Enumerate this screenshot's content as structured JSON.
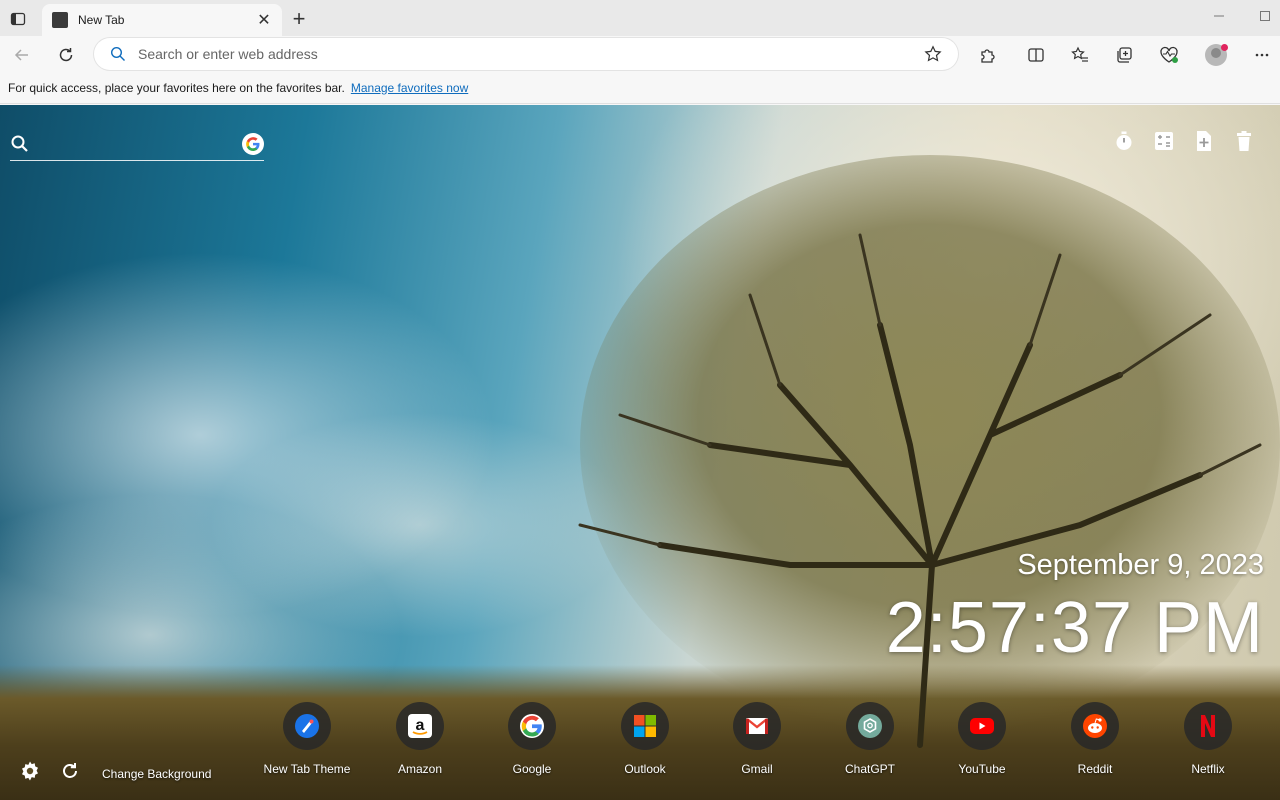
{
  "browser": {
    "tab": {
      "title": "New Tab"
    },
    "new_tab_symbol": "+",
    "close_symbol": "✕",
    "address": {
      "placeholder": "Search or enter web address",
      "value": ""
    }
  },
  "favorites_bar": {
    "message": "For quick access, place your favorites here on the favorites bar.",
    "link": "Manage favorites now"
  },
  "page": {
    "search": {
      "placeholder": "",
      "engine_icon": "google-icon"
    },
    "date": "September 9, 2023",
    "time": "2:57:37 PM",
    "change_background": "Change Background",
    "shortcuts": [
      {
        "label": "New Tab Theme",
        "icon": "new-tab-theme-icon"
      },
      {
        "label": "Amazon",
        "icon": "amazon-icon"
      },
      {
        "label": "Google",
        "icon": "google-icon"
      },
      {
        "label": "Outlook",
        "icon": "microsoft-icon"
      },
      {
        "label": "Gmail",
        "icon": "gmail-icon"
      },
      {
        "label": "ChatGPT",
        "icon": "chatgpt-icon"
      },
      {
        "label": "YouTube",
        "icon": "youtube-icon"
      },
      {
        "label": "Reddit",
        "icon": "reddit-icon"
      },
      {
        "label": "Netflix",
        "icon": "netflix-icon"
      }
    ]
  },
  "colors": {
    "accent_link": "#0f6cbd",
    "notification_dot": "#e0245e",
    "netflix_red": "#e50914",
    "youtube_red": "#ff0000",
    "reddit_orange": "#ff4500"
  }
}
